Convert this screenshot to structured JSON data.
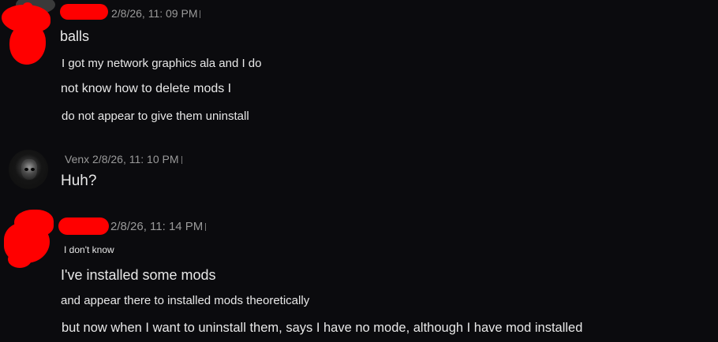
{
  "messages": [
    {
      "author": "",
      "timestamp": "2/8/26, 11: 09 PM",
      "lines": [
        "balls",
        "I got my network graphics ala and I do",
        "not know how to delete mods I",
        "do not appear to give them uninstall"
      ]
    },
    {
      "author": "Venx",
      "timestamp": "2/8/26, 11: 10 PM",
      "lines": [
        "Huh?"
      ]
    },
    {
      "author": "",
      "timestamp": "2/8/26, 11: 14 PM",
      "lines": [
        "I don't know",
        "I've installed some mods",
        "and appear there to installed mods theoretically",
        "but now when I want to uninstall them, says I have no mode, although I have mod installed"
      ]
    }
  ],
  "colors": {
    "background": "#0b0b0e",
    "text": "#e8e8e8",
    "meta": "#9a9a9a",
    "redaction": "#ff0000"
  }
}
